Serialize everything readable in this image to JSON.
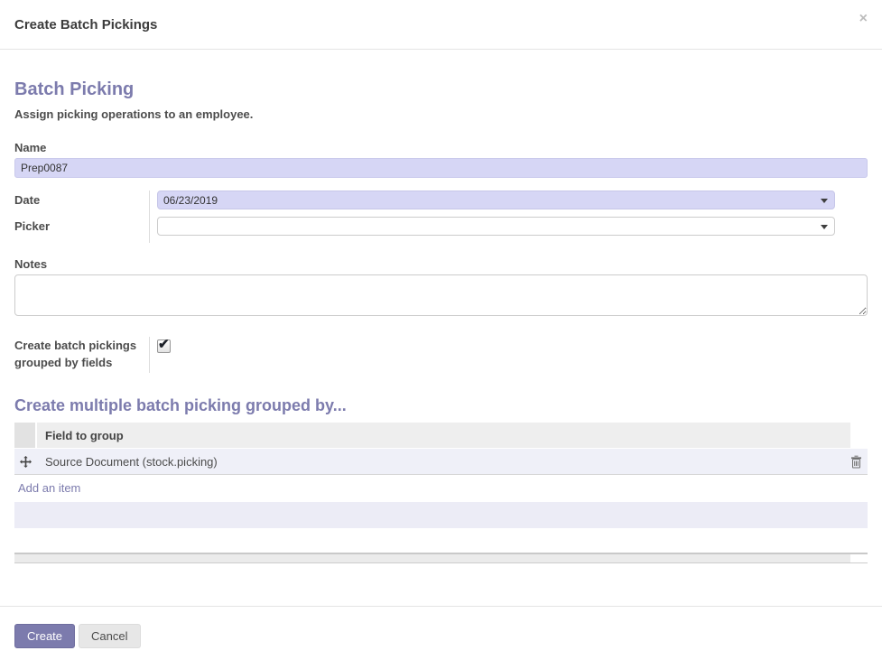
{
  "modal": {
    "title": "Create Batch Pickings"
  },
  "icons": {
    "close": "×",
    "check": "✔"
  },
  "form": {
    "heading": "Batch Picking",
    "subtitle": "Assign picking operations to an employee.",
    "name": {
      "label": "Name",
      "value": "Prep0087"
    },
    "date": {
      "label": "Date",
      "value": "06/23/2019"
    },
    "picker": {
      "label": "Picker",
      "value": ""
    },
    "notes": {
      "label": "Notes",
      "value": ""
    },
    "grouped_checkbox": {
      "label": "Create batch pickings grouped by fields",
      "checked": true
    }
  },
  "group_section": {
    "heading": "Create multiple batch picking grouped by...",
    "table": {
      "header": "Field to group",
      "rows": [
        {
          "field": "Source Document (stock.picking)"
        }
      ],
      "add_item_label": "Add an item"
    }
  },
  "footer": {
    "create_label": "Create",
    "cancel_label": "Cancel"
  },
  "colors": {
    "accent_purple": "#7c7bad",
    "field_highlight": "#d6d6f5",
    "row_highlight": "#eff0f8"
  }
}
